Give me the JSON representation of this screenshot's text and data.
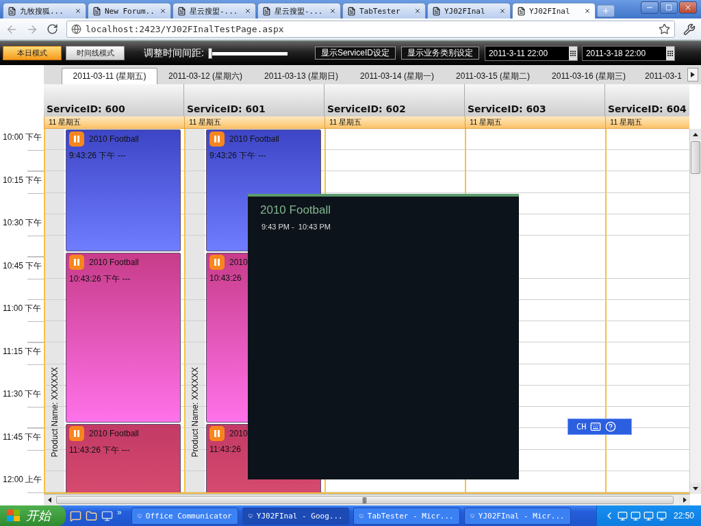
{
  "browser": {
    "tabs": [
      {
        "label": "九牧搜狐...",
        "selected": false
      },
      {
        "label": "New Forum...",
        "selected": false
      },
      {
        "label": "星云搜盟-...",
        "selected": false
      },
      {
        "label": "星云搜盟-...",
        "selected": false
      },
      {
        "label": "TabTester",
        "selected": false
      },
      {
        "label": "YJ02FInal",
        "selected": false
      },
      {
        "label": "YJ02FInal",
        "selected": true
      }
    ],
    "address": "localhost:2423/YJ02FInalTestPage.aspx"
  },
  "toolbar": {
    "modes": [
      {
        "label": "本日模式",
        "selected": true
      },
      {
        "label": "时间线模式",
        "selected": false
      }
    ],
    "interval_label": "调整时间间距:",
    "interval_slider": {
      "level": 0
    },
    "buttons": [
      "显示ServiceID设定",
      "显示业务类别设定"
    ],
    "date_fields": [
      "2011-3-11 22:00",
      "2011-3-18 22:00"
    ]
  },
  "date_tabs": [
    {
      "label": "2011-03-11 (星期五)",
      "selected": true
    },
    {
      "label": "2011-03-12 (星期六)",
      "selected": false
    },
    {
      "label": "2011-03-13 (星期日)",
      "selected": false
    },
    {
      "label": "2011-03-14 (星期一)",
      "selected": false
    },
    {
      "label": "2011-03-15 (星期二)",
      "selected": false
    },
    {
      "label": "2011-03-16 (星期三)",
      "selected": false
    },
    {
      "label": "2011-03-1",
      "selected": false
    }
  ],
  "times": [
    "10:00 下午",
    "10:15 下午",
    "10:30 下午",
    "10:45 下午",
    "11:00 下午",
    "11:15 下午",
    "11:30 下午",
    "11:45 下午",
    "12:00 上午"
  ],
  "services": [
    {
      "title": "ServiceID: 600",
      "day": "11 星期五",
      "product_name": "Product Name: XXXXXX",
      "events": [
        {
          "title": "2010 Football",
          "time": "9:43:26 下午 ---",
          "kind": "blue"
        },
        {
          "title": "2010 Football",
          "time": "10:43:26 下午 ---",
          "kind": "pink"
        },
        {
          "title": "2010 Football",
          "time": "11:43:26 下午 ---",
          "kind": "red"
        }
      ]
    },
    {
      "title": "ServiceID: 601",
      "day": "11 星期五",
      "product_name": "Product Name: XXXXXX",
      "events": [
        {
          "title": "2010 Football",
          "time": "9:43:26 下午 ---",
          "kind": "blue"
        },
        {
          "title": "2010",
          "time": "10:43:26",
          "kind": "pink"
        },
        {
          "title": "2010",
          "time": "11:43:26",
          "kind": "red"
        }
      ]
    },
    {
      "title": "ServiceID: 602",
      "day": "11 星期五"
    },
    {
      "title": "ServiceID: 603",
      "day": "11 星期五"
    },
    {
      "title": "ServiceID: 604",
      "day": "11 星期五"
    }
  ],
  "popup": {
    "title": "2010 Football",
    "time": "9:43 PM -  10:43 PM"
  },
  "ime": {
    "language": "CH"
  },
  "taskbar": {
    "start": "开始",
    "more": "»",
    "tasks": [
      {
        "label": "Office Communicator",
        "selected": false
      },
      {
        "label": "YJ02FInal - Goog...",
        "selected": true
      },
      {
        "label": "TabTester - Micr...",
        "selected": false
      },
      {
        "label": "YJ02FInal - Micr...",
        "selected": false
      }
    ],
    "clock": "22:50"
  }
}
